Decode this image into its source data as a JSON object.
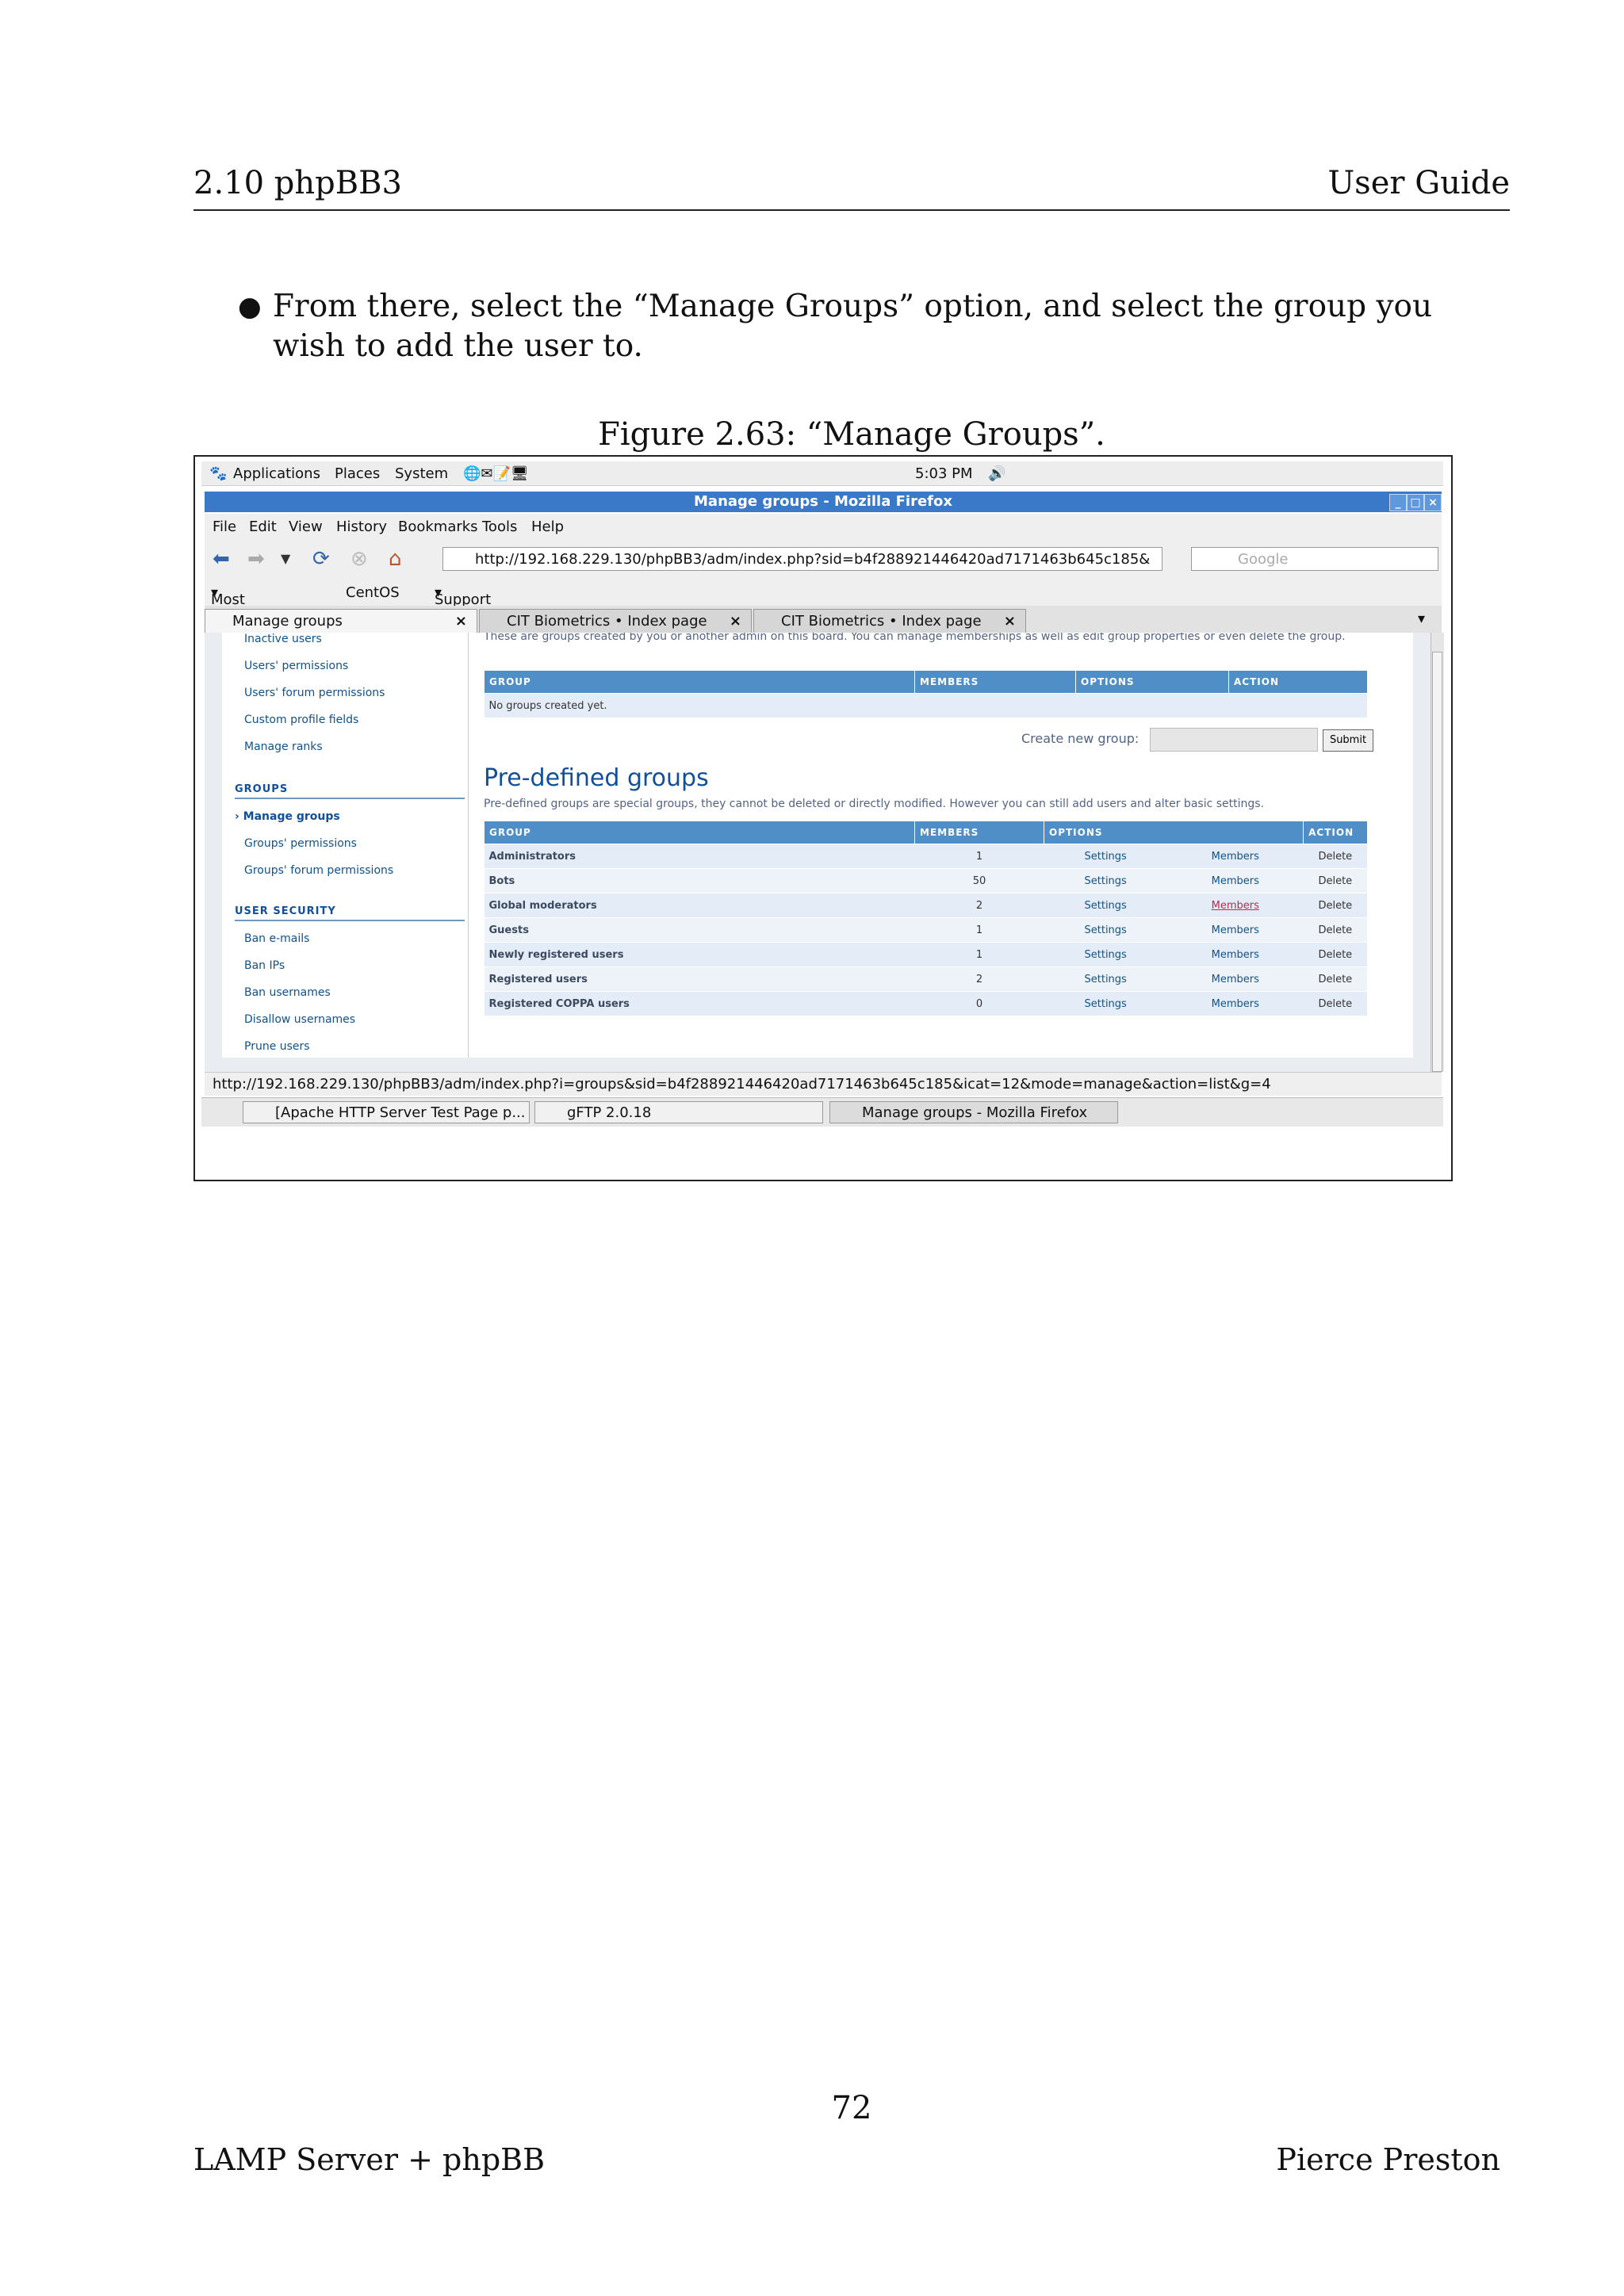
{
  "header": {
    "section": "2.10 phpBB3",
    "title": "User Guide"
  },
  "body": {
    "bullet": "From there, select the “Manage Groups” option, and select the group you wish to add the user to.",
    "caption": "Figure 2.63: “Manage Groups”."
  },
  "screenshot": {
    "gnome": {
      "applications": "Applications",
      "places": "Places",
      "system": "System",
      "clock": "5:03 PM"
    },
    "window_title": "Manage groups - Mozilla Firefox",
    "menu": [
      "File",
      "Edit",
      "View",
      "History",
      "Bookmarks",
      "Tools",
      "Help"
    ],
    "url": "http://192.168.229.130/phpBB3/adm/index.php?sid=b4f288921446420ad7171463b645c185&",
    "search_placeholder": "Google",
    "bookmarks": [
      "Most Visited",
      "CentOS",
      "Support"
    ],
    "tabs": [
      "Manage groups",
      "CIT Biometrics • Index page",
      "CIT Biometrics • Index page"
    ],
    "sidebar": {
      "users_links": [
        "Inactive users",
        "Users' permissions",
        "Users' forum permissions",
        "Custom profile fields",
        "Manage ranks"
      ],
      "groups_heading": "GROUPS",
      "groups_links": [
        "Manage groups",
        "Groups' permissions",
        "Groups' forum permissions"
      ],
      "security_heading": "USER SECURITY",
      "security_links": [
        "Ban e-mails",
        "Ban IPs",
        "Ban usernames",
        "Disallow usernames",
        "Prune users"
      ]
    },
    "main": {
      "intro": "These are groups created by you or another admin on this board. You can manage memberships as well as edit group properties or even delete the group.",
      "columns": [
        "GROUP",
        "MEMBERS",
        "OPTIONS",
        "ACTION"
      ],
      "empty_text": "No groups created yet.",
      "create_label": "Create new group:",
      "submit_label": "Submit",
      "predefined_title": "Pre-defined groups",
      "predefined_desc": "Pre-defined groups are special groups, they cannot be deleted or directly modified. However you can still add users and alter basic settings.",
      "rows": [
        {
          "name": "Administrators",
          "members": "1",
          "settings": "Settings",
          "members_link": "Members",
          "delete": "Delete"
        },
        {
          "name": "Bots",
          "members": "50",
          "settings": "Settings",
          "members_link": "Members",
          "delete": "Delete"
        },
        {
          "name": "Global moderators",
          "members": "2",
          "settings": "Settings",
          "members_link": "Members",
          "delete": "Delete"
        },
        {
          "name": "Guests",
          "members": "1",
          "settings": "Settings",
          "members_link": "Members",
          "delete": "Delete"
        },
        {
          "name": "Newly registered users",
          "members": "1",
          "settings": "Settings",
          "members_link": "Members",
          "delete": "Delete"
        },
        {
          "name": "Registered users",
          "members": "2",
          "settings": "Settings",
          "members_link": "Members",
          "delete": "Delete"
        },
        {
          "name": "Registered COPPA users",
          "members": "0",
          "settings": "Settings",
          "members_link": "Members",
          "delete": "Delete"
        }
      ]
    },
    "status_url": "http://192.168.229.130/phpBB3/adm/index.php?i=groups&sid=b4f288921446420ad7171463b645c185&icat=12&mode=manage&action=list&g=4",
    "taskbar": [
      "[Apache HTTP Server Test Page p...",
      "gFTP 2.0.18",
      "Manage groups - Mozilla Firefox"
    ]
  },
  "footer": {
    "page": "72",
    "left": "LAMP Server + phpBB",
    "right": "Pierce Preston"
  }
}
